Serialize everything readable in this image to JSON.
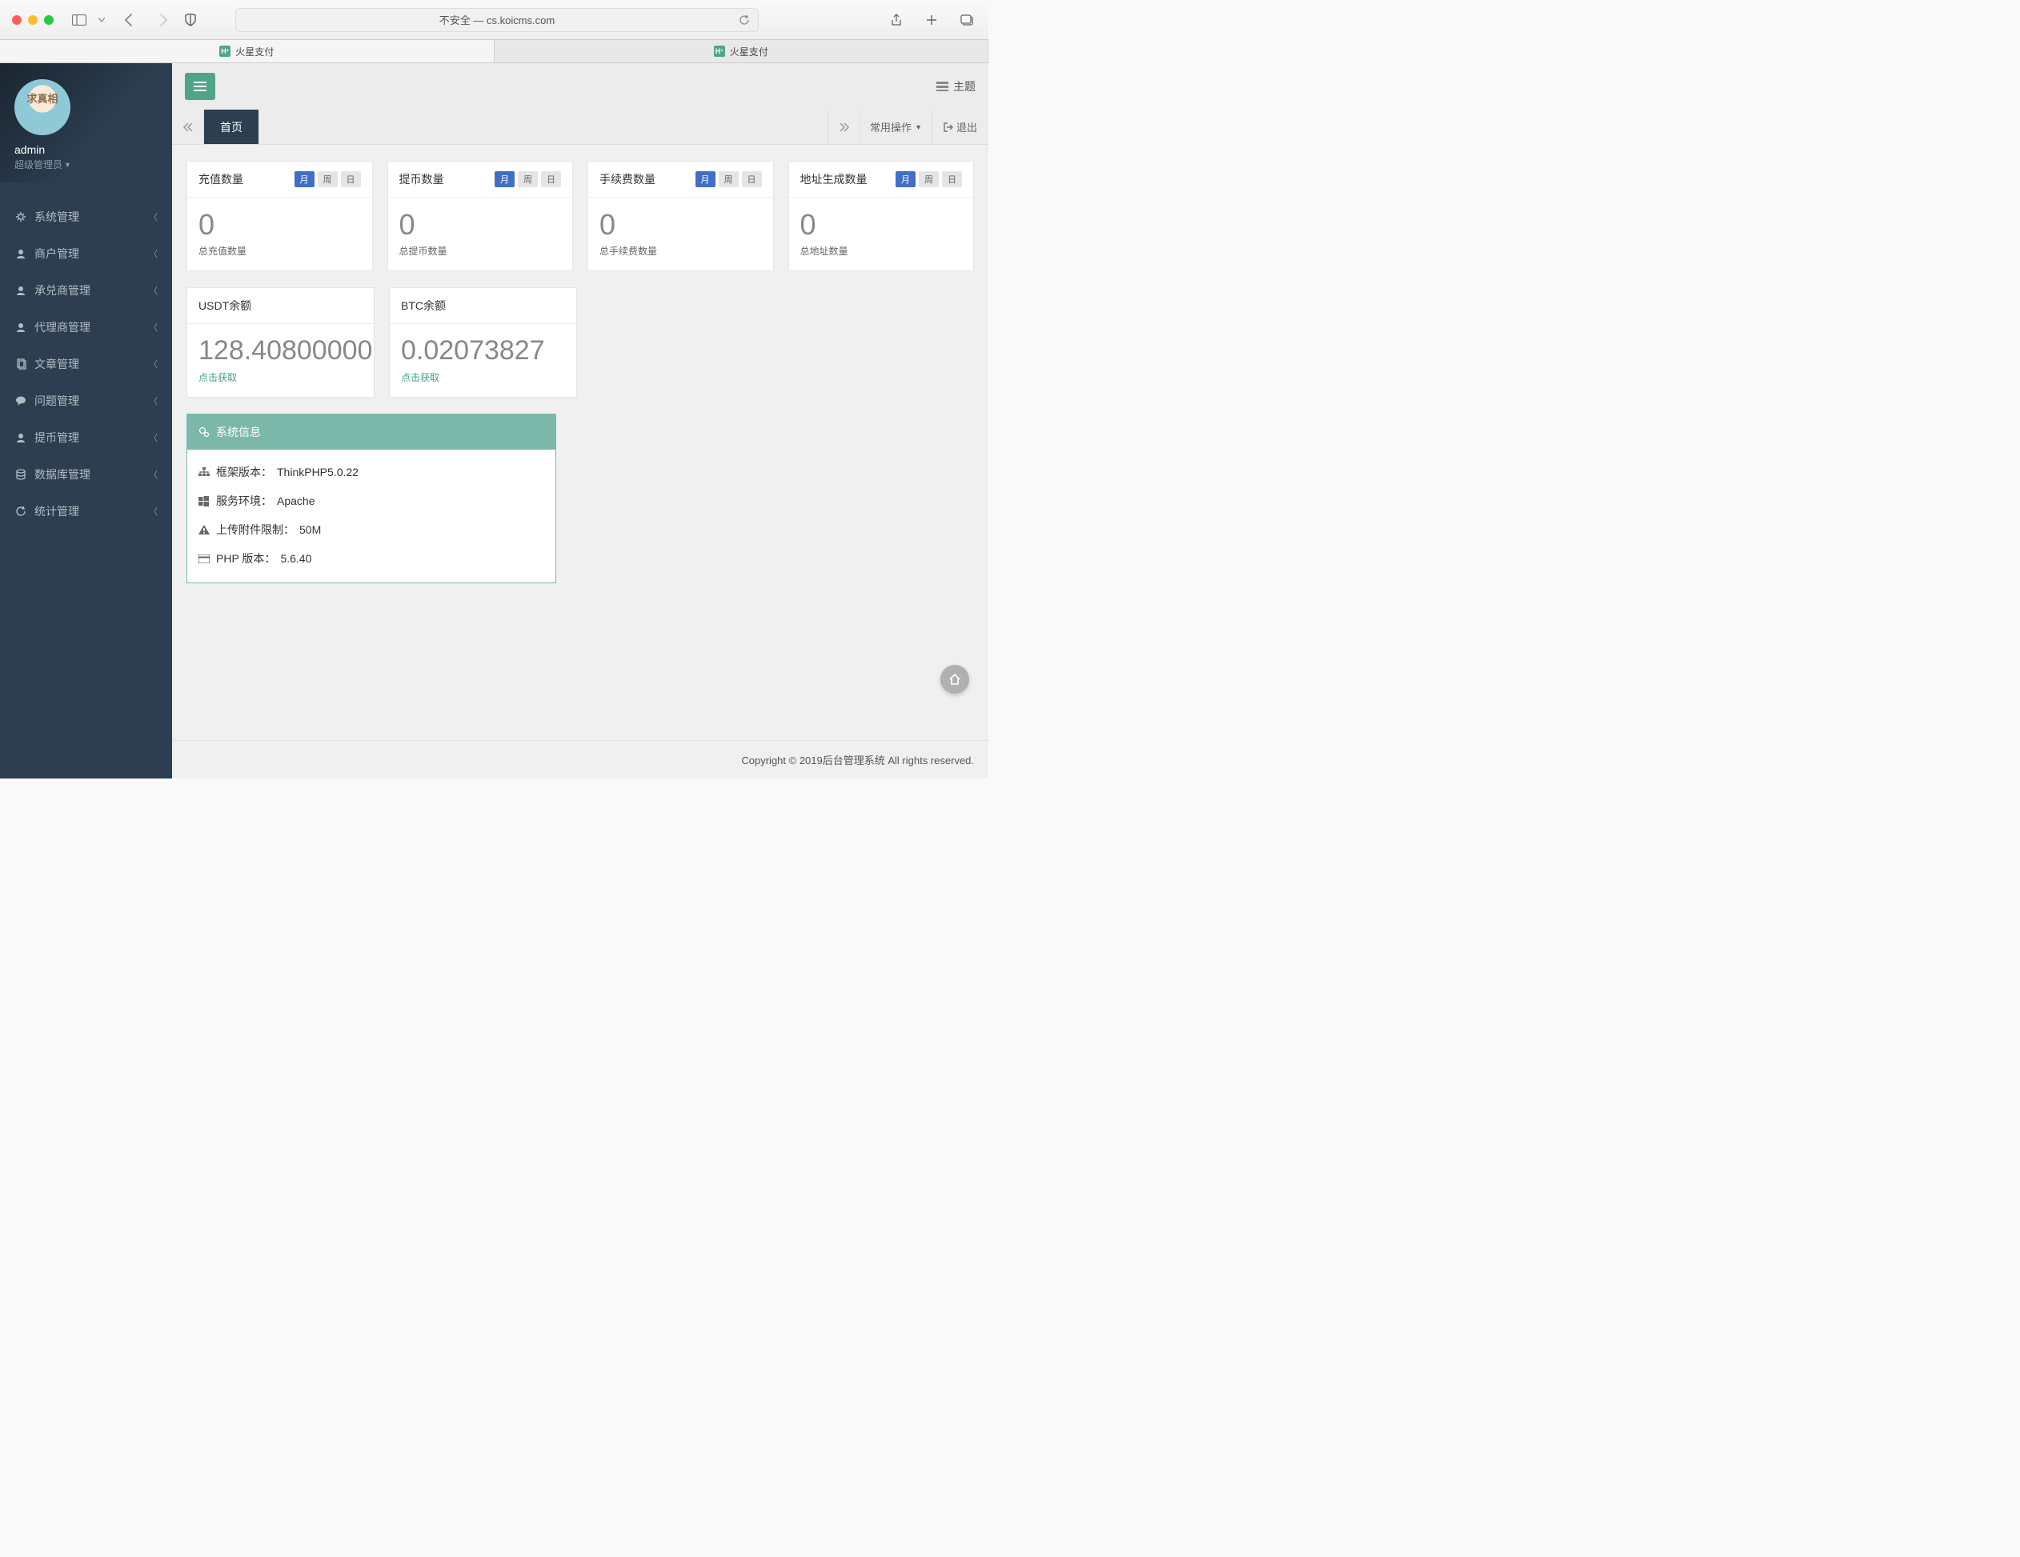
{
  "browser": {
    "url_label": "不安全 — cs.koicms.com",
    "tabs": [
      {
        "label": "火星支付",
        "active": true
      },
      {
        "label": "火星支付",
        "active": false
      }
    ]
  },
  "sidebar": {
    "avatar_text": "求真相",
    "username": "admin",
    "role": "超级管理员",
    "menu": [
      {
        "label": "系统管理",
        "icon": "gear"
      },
      {
        "label": "商户管理",
        "icon": "user"
      },
      {
        "label": "承兑商管理",
        "icon": "user"
      },
      {
        "label": "代理商管理",
        "icon": "user"
      },
      {
        "label": "文章管理",
        "icon": "copy"
      },
      {
        "label": "问题管理",
        "icon": "comment"
      },
      {
        "label": "提币管理",
        "icon": "user"
      },
      {
        "label": "数据库管理",
        "icon": "database"
      },
      {
        "label": "统计管理",
        "icon": "refresh"
      }
    ]
  },
  "topbar": {
    "theme_label": "主题"
  },
  "tabrow": {
    "home_label": "首页",
    "common_ops": "常用操作",
    "logout": "退出"
  },
  "stats": {
    "period_labels": {
      "month": "月",
      "week": "周",
      "day": "日"
    },
    "cards": [
      {
        "title": "充值数量",
        "value": "0",
        "sub": "总充值数量"
      },
      {
        "title": "提币数量",
        "value": "0",
        "sub": "总提币数量"
      },
      {
        "title": "手续费数量",
        "value": "0",
        "sub": "总手续费数量"
      },
      {
        "title": "地址生成数量",
        "value": "0",
        "sub": "总地址数量"
      }
    ]
  },
  "balances": [
    {
      "title": "USDT余额",
      "value": "128.40800000",
      "action": "点击获取"
    },
    {
      "title": "BTC余额",
      "value": "0.02073827",
      "action": "点击获取"
    }
  ],
  "sysinfo": {
    "title": "系统信息",
    "rows": [
      {
        "label": "框架版本：",
        "value": "ThinkPHP5.0.22",
        "icon": "sitemap"
      },
      {
        "label": "服务环境：",
        "value": "Apache",
        "icon": "windows"
      },
      {
        "label": "上传附件限制：",
        "value": "50M",
        "icon": "warning"
      },
      {
        "label": "PHP 版本：",
        "value": "5.6.40",
        "icon": "card"
      }
    ]
  },
  "footer": "Copyright © 2019后台管理系统 All rights reserved."
}
